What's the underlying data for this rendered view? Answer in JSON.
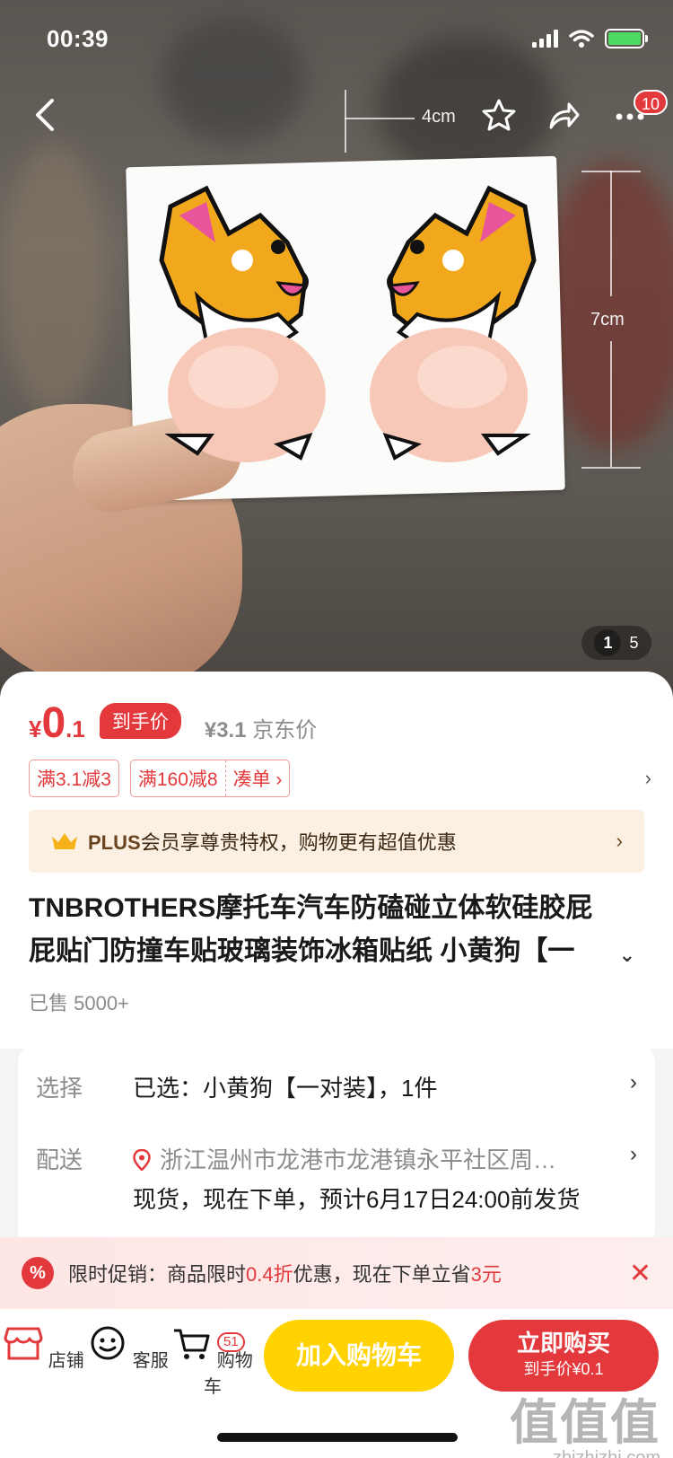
{
  "status_bar": {
    "time": "00:39"
  },
  "nav": {
    "message_badge": "10"
  },
  "photo": {
    "dimension_width": "4cm",
    "dimension_height": "7cm",
    "counter_current": "1",
    "counter_total": "5"
  },
  "price": {
    "symbol": "¥",
    "integer": "0",
    "decimal": ".1",
    "tag": "到手价",
    "jd_price": "¥3.1",
    "jd_price_label": "京东价"
  },
  "coupons": [
    "满3.1减3",
    "满160减8"
  ],
  "coupon_action": "凑单",
  "plus": {
    "text_bold": "PLUS",
    "text": "会员享尊贵特权，购物更有超值优惠"
  },
  "product": {
    "title_line1": "TNBROTHERS摩托车汽车防磕碰立体软硅胶屁",
    "title_line2": "屁贴门防撞车贴玻璃装饰冰箱贴纸 小黄狗【一",
    "sold": "已售 5000+"
  },
  "selection": {
    "label": "选择",
    "value": "已选：小黄狗【一对装】，1件"
  },
  "delivery": {
    "label": "配送",
    "address": "浙江温州市龙港市龙港镇永平社区周…",
    "note": "现货，现在下单，预计6月17日24:00前发货"
  },
  "promo": {
    "prefix": "限时促销：商品限时",
    "discount": "0.4折",
    "mid": "优惠，现在下单立省",
    "saving": "3元"
  },
  "bottom_bar": {
    "store": "店铺",
    "service": "客服",
    "cart": "购物车",
    "cart_count": "51",
    "add_to_cart": "加入购物车",
    "buy_now": "立即购买",
    "buy_now_sub": "到手价¥0.1"
  },
  "watermark": {
    "logo": "值值值",
    "url": "zhizhizhi.com"
  },
  "colors": {
    "brand_red": "#e4393c",
    "cart_yellow": "#ffd200",
    "plus_bg": "#fbf0e1"
  }
}
